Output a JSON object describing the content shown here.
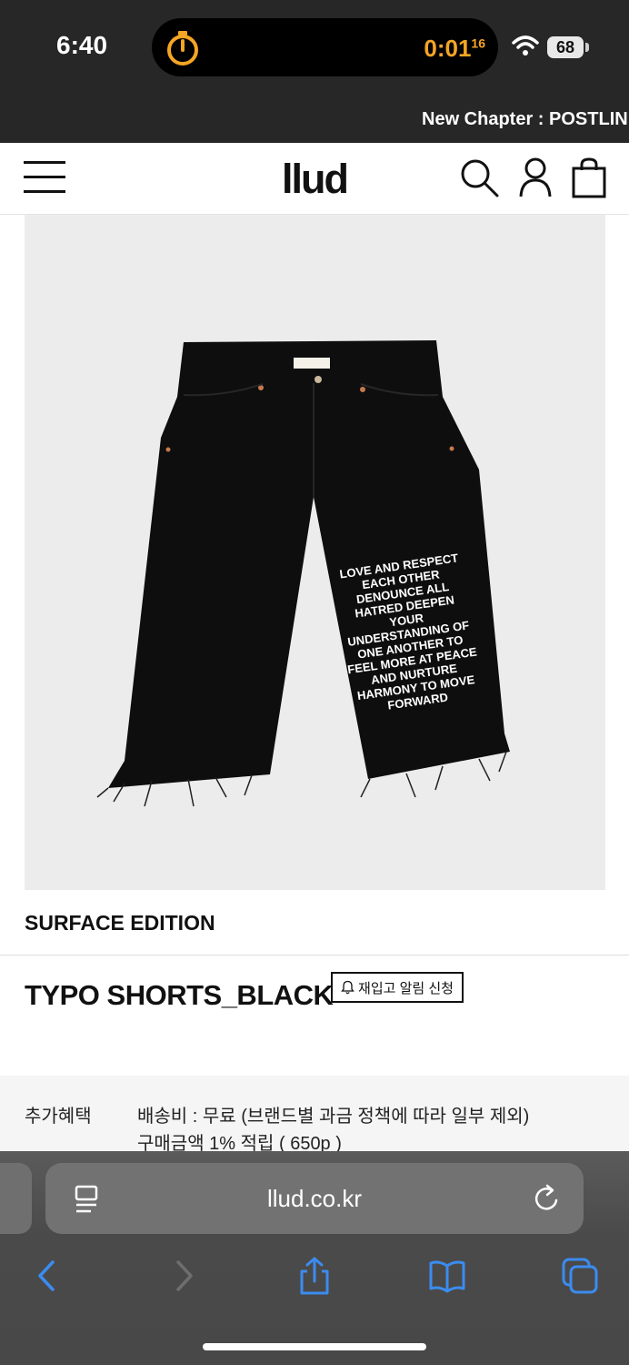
{
  "status_bar": {
    "time": "6:40",
    "timer": "0:01",
    "timer_sup": "16",
    "battery": "68"
  },
  "promo": {
    "text": "New Chapter : POSTLIN"
  },
  "header": {
    "logo": "llud"
  },
  "product": {
    "brand": "SURFACE EDITION",
    "name": "TYPO SHORTS_BLACK",
    "restock_button": "재입고 알림 신청",
    "print_text": [
      "LOVE AND RESPECT",
      "EACH OTHER",
      "DENOUNCE ALL",
      "HATRED DEEPEN",
      "YOUR",
      "UNDERSTANDING OF",
      "ONE ANOTHER TO",
      "FEEL MORE AT PEACE",
      "AND NURTURE",
      "HARMONY TO MOVE",
      "FORWARD"
    ]
  },
  "benefit": {
    "label": "추가혜택",
    "line1": "배송비 : 무료 (브랜드별 과금 정책에 따라 일부 제외)",
    "line2": "구매금액 1% 적립 ( 650p )"
  },
  "browser": {
    "url": "llud.co.kr"
  },
  "colors": {
    "accent_timer": "#f5a524",
    "ios_blue": "#3b8cf0",
    "header_bg": "#ffffff",
    "status_bg": "#272727"
  }
}
